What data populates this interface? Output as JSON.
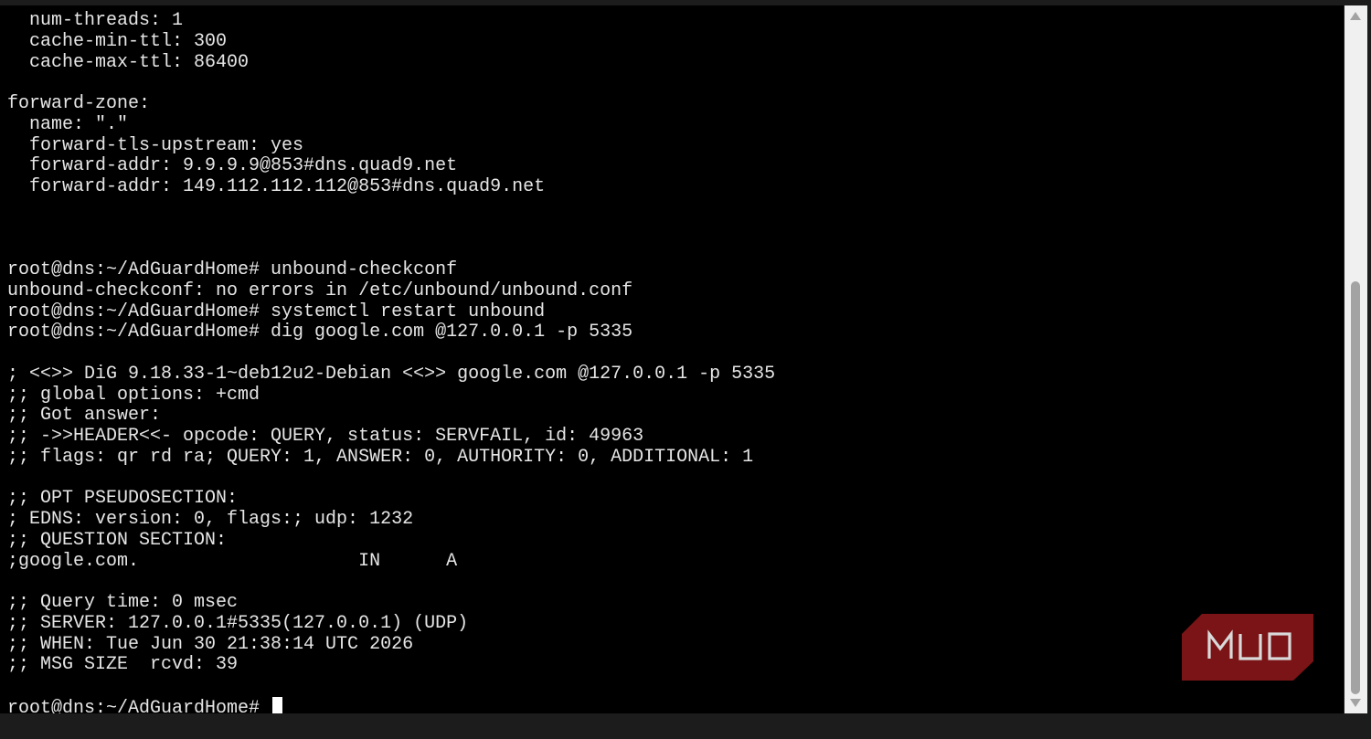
{
  "terminal": {
    "lines": [
      "  num-threads: 1",
      "  cache-min-ttl: 300",
      "  cache-max-ttl: 86400",
      "",
      "forward-zone:",
      "  name: \".\"",
      "  forward-tls-upstream: yes",
      "  forward-addr: 9.9.9.9@853#dns.quad9.net",
      "  forward-addr: 149.112.112.112@853#dns.quad9.net",
      "",
      "",
      "",
      "root@dns:~/AdGuardHome# unbound-checkconf",
      "unbound-checkconf: no errors in /etc/unbound/unbound.conf",
      "root@dns:~/AdGuardHome# systemctl restart unbound",
      "root@dns:~/AdGuardHome# dig google.com @127.0.0.1 -p 5335",
      "",
      "; <<>> DiG 9.18.33-1~deb12u2-Debian <<>> google.com @127.0.0.1 -p 5335",
      ";; global options: +cmd",
      ";; Got answer:",
      ";; ->>HEADER<<- opcode: QUERY, status: SERVFAIL, id: 49963",
      ";; flags: qr rd ra; QUERY: 1, ANSWER: 0, AUTHORITY: 0, ADDITIONAL: 1",
      "",
      ";; OPT PSEUDOSECTION:",
      "; EDNS: version: 0, flags:; udp: 1232",
      ";; QUESTION SECTION:",
      ";google.com.                    IN      A",
      "",
      ";; Query time: 0 msec",
      ";; SERVER: 127.0.0.1#5335(127.0.0.1) (UDP)",
      ";; WHEN: Tue Jun 30 21:38:14 UTC 2026",
      ";; MSG SIZE  rcvd: 39",
      ""
    ],
    "prompt": "root@dns:~/AdGuardHome# "
  },
  "watermark": {
    "text": "MUO",
    "color": "#7a1416"
  },
  "colors": {
    "terminal_bg": "#000000",
    "terminal_fg": "#e6e6e6",
    "scrollbar_bg": "#f0f0f0",
    "scrollbar_thumb": "#a3a3a3"
  },
  "scrollbar": {
    "position_fraction": 0.6
  }
}
